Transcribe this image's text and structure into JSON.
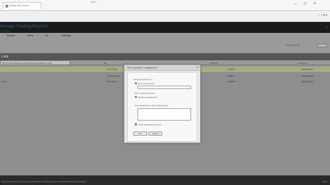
{
  "browser": {
    "tab_title": "Manage Site Content",
    "new_tab": "+",
    "address": "http://",
    "controls": [
      "–",
      "□",
      "×"
    ]
  },
  "cmdbar": {
    "right_text": "☆ ⌂ ⚙ ▾"
  },
  "app": {
    "title": "Manage Pending Records",
    "subtitle": "Site Actions"
  },
  "ribbon": {
    "tabs": [
      "Browse",
      "Items",
      "List",
      "Settings"
    ],
    "search_link": "Search this site"
  },
  "section": {
    "title": "Lists"
  },
  "list": {
    "url_text": "http://intranet/sites/records/Lists/Pending/AllItems.aspx",
    "headers": [
      "Title",
      "Modified",
      "Created By"
    ],
    "rows": [
      {
        "name": "New Policy",
        "date": "1/1/2012",
        "user": "Administrator"
      },
      {
        "name": "Workflow Doc",
        "date": "1/1/2012",
        "user": "Administrator"
      },
      {
        "name": "Notice file",
        "date": "1/1/2012",
        "user": "Administrator"
      }
    ],
    "left_tag": "Items"
  },
  "dialog": {
    "title": "Set Property to Unapproved",
    "close": "×",
    "label_apply": "Set this property to a",
    "option_one": "New Unapproved",
    "label_field": "New Unapproved item",
    "option_two": "Existing Unapproved",
    "label_desc": "Set a description of the Unapproved",
    "check_label": "Notify selected reviewers",
    "ok": "Ok",
    "cancel": "Cancel"
  },
  "status": {
    "left": "http://intranet/sites/records/_layouts/listform.aspx?PageType=4&ListId=Pending&RootFolder=",
    "right": "100%"
  }
}
